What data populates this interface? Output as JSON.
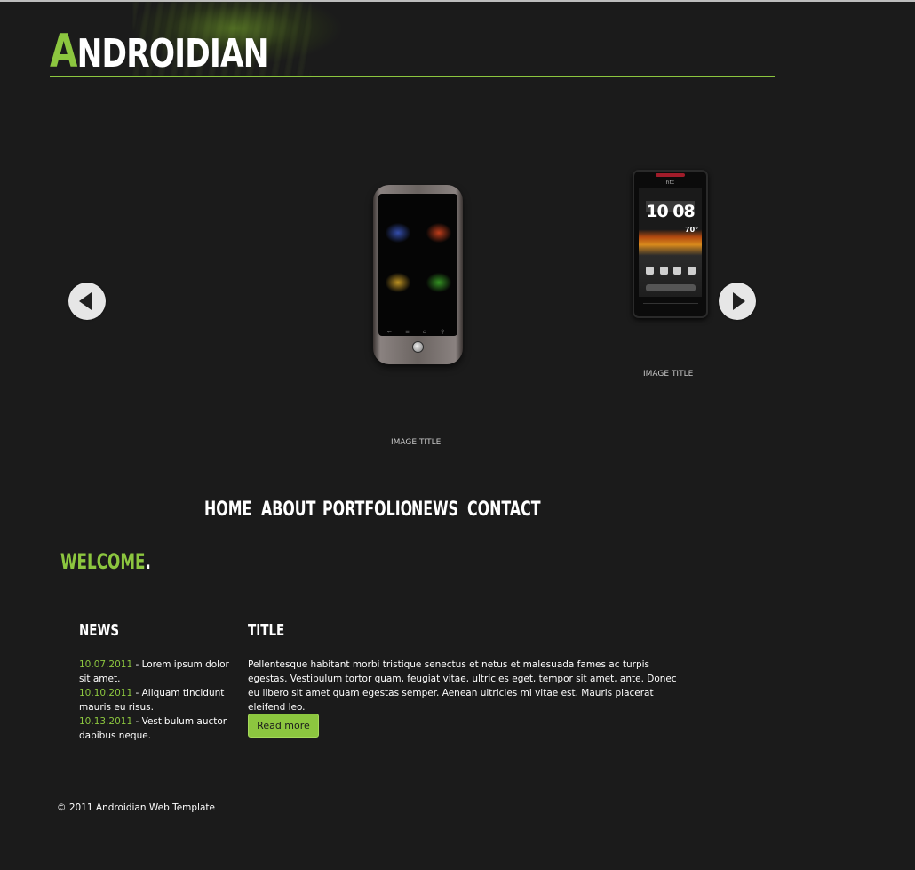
{
  "header": {
    "logo_first_letter": "A",
    "logo_rest": "NDROIDIAN"
  },
  "slider": {
    "slides": [
      {
        "caption": "IMAGE TITLE"
      },
      {
        "caption": "IMAGE TITLE",
        "brand": "htc",
        "clock": "10 08",
        "temperature": "70°"
      }
    ]
  },
  "nav": {
    "items": [
      {
        "label": "HOME"
      },
      {
        "label": "ABOUT"
      },
      {
        "label": "PORTFOLIO"
      },
      {
        "label": "NEWS"
      },
      {
        "label": "CONTACT"
      }
    ]
  },
  "welcome": {
    "text": "WELCOME",
    "dot": "."
  },
  "news": {
    "title": "NEWS",
    "items": [
      {
        "date": "10.07.2011",
        "text": " - Lorem ipsum dolor sit amet."
      },
      {
        "date": "10.10.2011",
        "text": " - Aliquam tincidunt mauris eu risus."
      },
      {
        "date": "10.13.2011",
        "text": " - Vestibulum auctor dapibus neque."
      }
    ]
  },
  "main": {
    "title": "TITLE",
    "body": "Pellentesque habitant morbi tristique senectus et netus et malesuada fames ac turpis egestas. Vestibulum tortor quam, feugiat vitae, ultricies eget, tempor sit amet, ante. Donec eu libero sit amet quam egestas semper. Aenean ultricies mi vitae est. Mauris placerat eleifend leo.",
    "button_label": "Read more"
  },
  "footer": {
    "copyright": "© 2011 Androidian Web Template"
  },
  "colors": {
    "background": "#1b1b1b",
    "accent": "#8cc63f",
    "text": "#ffffff"
  }
}
